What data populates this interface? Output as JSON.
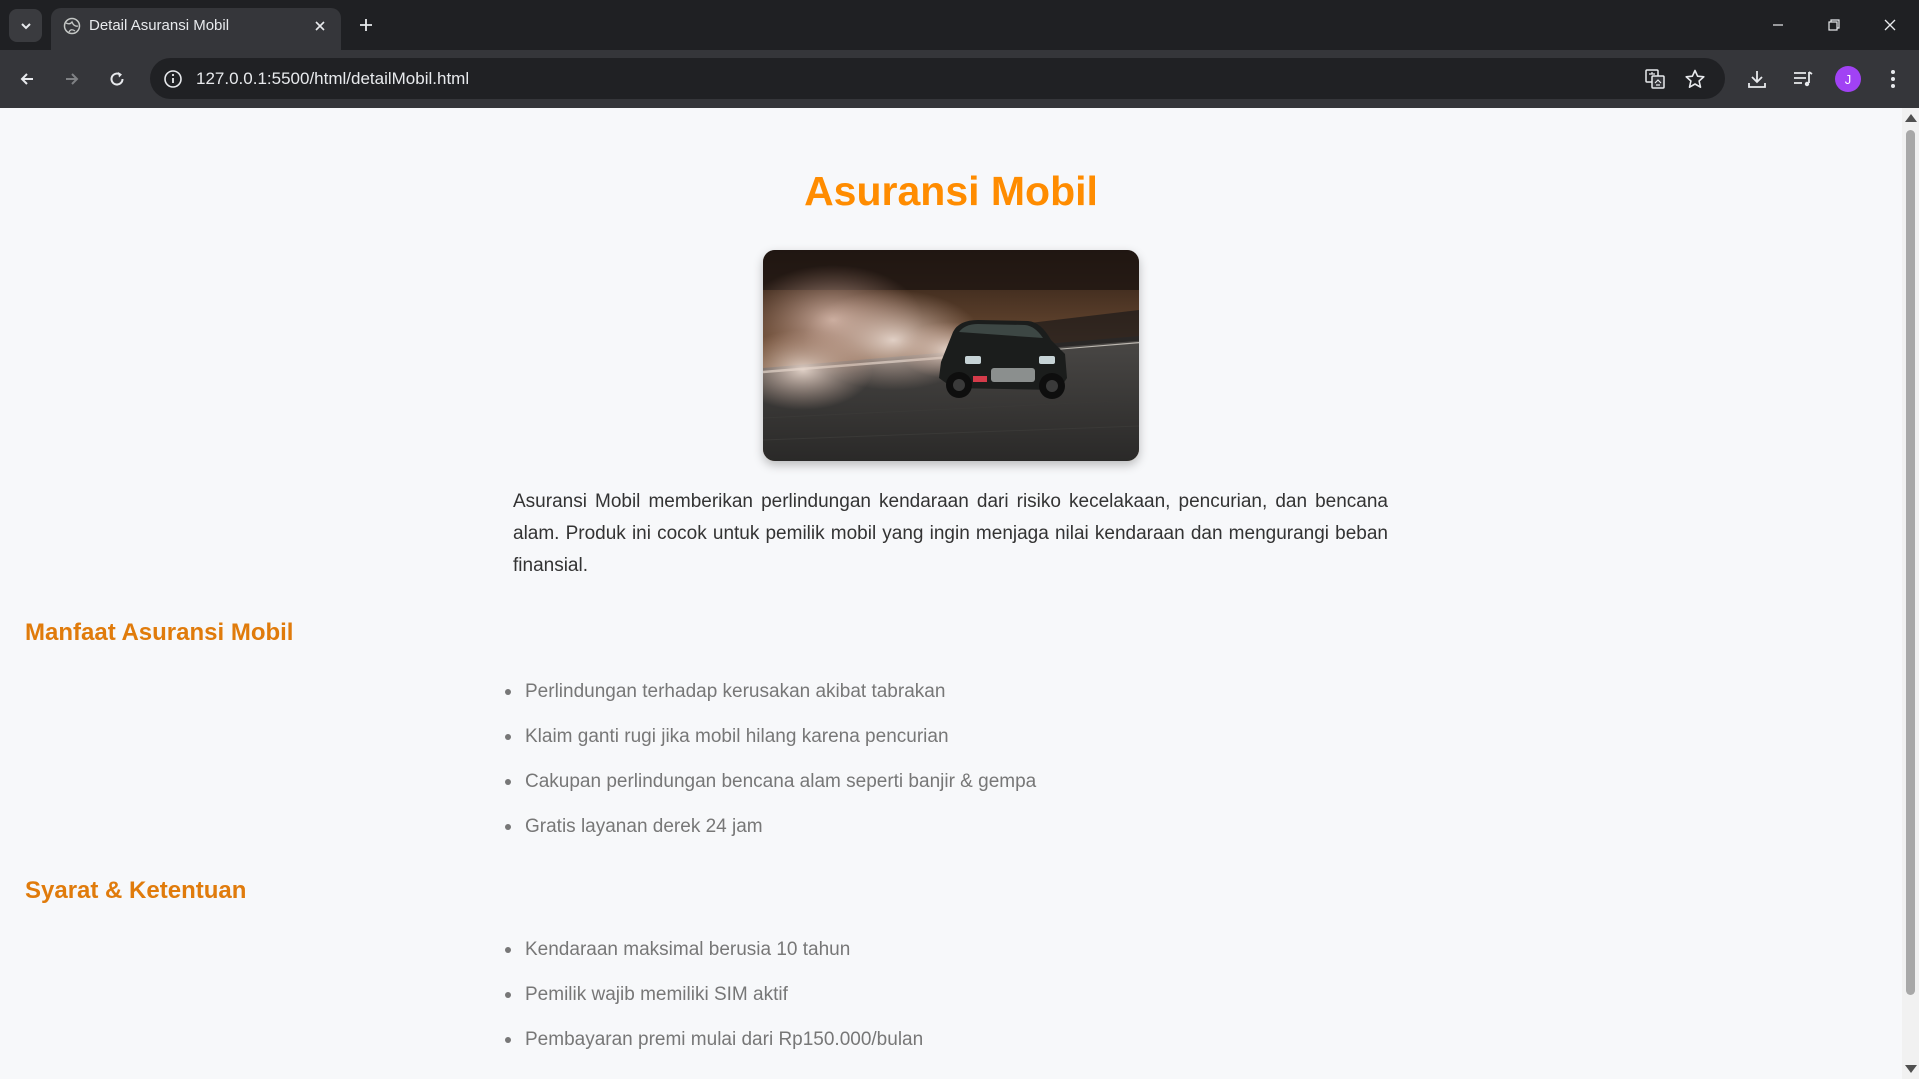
{
  "browser": {
    "tab_title": "Detail Asuransi Mobil",
    "url": "127.0.0.1:5500/html/detailMobil.html",
    "profile_initial": "J"
  },
  "page": {
    "title": "Asuransi Mobil",
    "hero_alt": "Mobil drifting",
    "description": "Asuransi Mobil memberikan perlindungan kendaraan dari risiko kecelakaan, pencurian, dan bencana alam. Produk ini cocok untuk pemilik mobil yang ingin menjaga nilai kendaraan dan mengurangi beban finansial.",
    "benefits": {
      "heading": "Manfaat Asuransi Mobil",
      "items": [
        "Perlindungan terhadap kerusakan akibat tabrakan",
        "Klaim ganti rugi jika mobil hilang karena pencurian",
        "Cakupan perlindungan bencana alam seperti banjir & gempa",
        "Gratis layanan derek 24 jam"
      ]
    },
    "terms": {
      "heading": "Syarat & Ketentuan",
      "items": [
        "Kendaraan maksimal berusia 10 tahun",
        "Pemilik wajib memiliki SIM aktif",
        "Pembayaran premi mulai dari Rp150.000/bulan"
      ]
    }
  },
  "colors": {
    "accent": "#ff8c00",
    "heading": "#e07b0b",
    "chrome_dark": "#1f2023",
    "chrome": "#35363a"
  }
}
